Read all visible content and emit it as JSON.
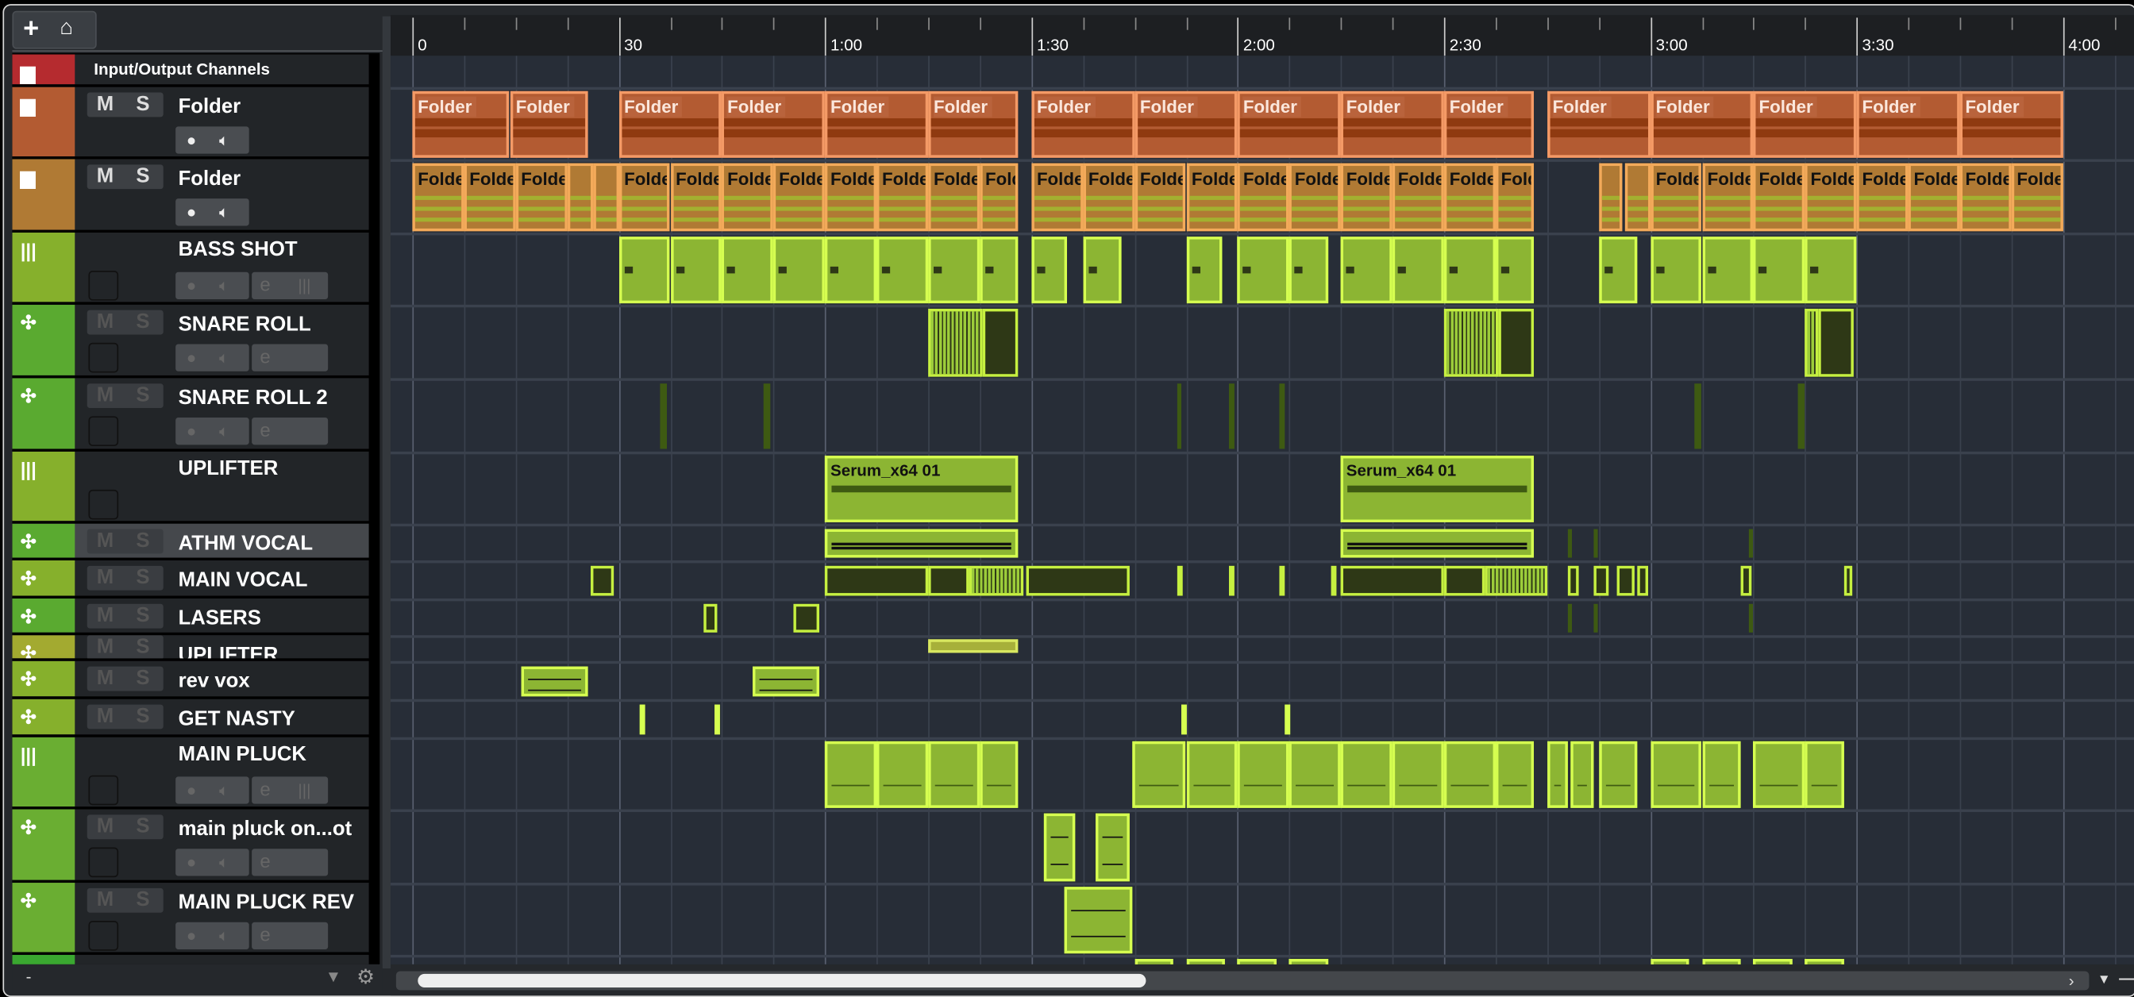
{
  "toolbar": {
    "add_icon": "+",
    "folder_icon": "⌂"
  },
  "ruler": {
    "labels": [
      "0",
      "30",
      "1:00",
      "1:30",
      "2:00",
      "2:30",
      "3:00",
      "3:30",
      "4:00"
    ],
    "bars_per_label": 4,
    "total_bars": 33.5
  },
  "footer": {
    "minus": "-"
  },
  "colors": {
    "io": "#b52b2f",
    "folder1": "#b35b32",
    "folder2": "#b07a34",
    "green": "#86b02c",
    "green2": "#5aaa30",
    "yellow": "#a3aa30"
  },
  "tracks": [
    {
      "name": "Input/Output Channels",
      "type": "io",
      "color": "#b52b2f",
      "icon": "folder-icon",
      "rows": 24,
      "clips": []
    },
    {
      "name": "Folder",
      "type": "folder",
      "color": "#b35b32",
      "icon": "folder-icon",
      "rows": 53,
      "style": "f1",
      "clip_label": "Folder",
      "clips": [
        [
          0,
          1.87
        ],
        [
          1.9,
          3.4
        ],
        [
          4,
          6
        ],
        [
          6,
          8
        ],
        [
          8,
          10
        ],
        [
          10,
          11.75
        ],
        [
          12,
          14
        ],
        [
          14,
          16
        ],
        [
          16,
          18
        ],
        [
          18,
          20
        ],
        [
          20,
          21.75
        ],
        [
          22,
          24
        ],
        [
          24,
          26
        ],
        [
          26,
          28
        ],
        [
          28,
          30
        ],
        [
          30,
          32
        ]
      ]
    },
    {
      "name": "Folder",
      "type": "folder",
      "color": "#b07a34",
      "icon": "folder-icon",
      "rows": 54,
      "style": "f2",
      "clip_label": "Folde",
      "clips": [
        [
          0,
          1
        ],
        [
          1,
          2
        ],
        [
          2,
          3
        ],
        [
          3,
          3.5,
          ""
        ],
        [
          3.5,
          4,
          ""
        ],
        [
          4,
          5
        ],
        [
          5,
          6
        ],
        [
          6,
          7
        ],
        [
          7,
          8
        ],
        [
          8,
          9
        ],
        [
          9,
          10
        ],
        [
          10,
          11
        ],
        [
          11,
          11.75
        ],
        [
          12,
          13
        ],
        [
          13,
          14
        ],
        [
          14,
          15
        ],
        [
          15,
          16
        ],
        [
          16,
          17
        ],
        [
          17,
          18
        ],
        [
          18,
          19
        ],
        [
          19,
          20
        ],
        [
          20,
          21
        ],
        [
          21,
          21.75
        ],
        [
          23,
          23.45,
          ""
        ],
        [
          23.5,
          24,
          ""
        ],
        [
          24,
          25
        ],
        [
          25,
          26
        ],
        [
          26,
          27
        ],
        [
          27,
          28
        ],
        [
          28,
          29
        ],
        [
          29,
          30
        ],
        [
          30,
          31
        ],
        [
          31,
          32
        ]
      ]
    },
    {
      "name": "BASS SHOT",
      "type": "inst",
      "color": "#86b02c",
      "icon": "piano-icon",
      "rows": 53,
      "style": "g",
      "clips": [
        [
          4,
          5
        ],
        [
          5,
          6
        ],
        [
          6,
          7
        ],
        [
          7,
          8
        ],
        [
          8,
          9
        ],
        [
          9,
          10
        ],
        [
          10,
          11
        ],
        [
          11,
          11.75
        ],
        [
          12,
          12.7
        ],
        [
          13,
          13.75
        ],
        [
          15,
          15.7
        ],
        [
          16,
          17
        ],
        [
          17,
          17.75
        ],
        [
          18,
          19
        ],
        [
          19,
          20
        ],
        [
          20,
          21
        ],
        [
          21,
          21.75
        ],
        [
          23,
          23.75
        ],
        [
          24,
          25
        ],
        [
          25,
          26
        ],
        [
          26,
          27
        ],
        [
          27,
          28
        ]
      ]
    },
    {
      "name": "SNARE ROLL",
      "type": "audio",
      "color": "#5aaa30",
      "icon": "waveform-icon",
      "rows": 54,
      "style": "roll",
      "clips": [
        [
          10,
          11.05
        ],
        [
          11.05,
          11.75,
          "",
          "gd"
        ],
        [
          20,
          21.05
        ],
        [
          21.05,
          21.75,
          "",
          "gd"
        ],
        [
          27,
          27.25
        ],
        [
          27.25,
          27.95,
          "",
          "gd"
        ]
      ]
    },
    {
      "name": "SNARE ROLL 2",
      "type": "audio",
      "color": "#5aaa30",
      "icon": "waveform-icon",
      "rows": 54,
      "style": "mk",
      "clips": [
        [
          4.8,
          4.93
        ],
        [
          6.8,
          6.93
        ],
        [
          14.82,
          14.92
        ],
        [
          15.82,
          15.95
        ],
        [
          16.82,
          16.92
        ],
        [
          24.85,
          24.98
        ],
        [
          26.85,
          26.98
        ]
      ]
    },
    {
      "name": "UPLIFTER",
      "type": "inst2",
      "color": "#86b02c",
      "icon": "piano-icon",
      "rows": 53,
      "style": "g",
      "clip_label": "Serum_x64 01",
      "clips": [
        [
          8,
          11.75
        ],
        [
          18,
          21.75
        ]
      ]
    },
    {
      "name": "ATHM VOCAL",
      "type": "short",
      "color": "#5aaa30",
      "icon": "waveform-icon",
      "rows": 27,
      "style": "g",
      "selected": true,
      "clips": [
        [
          8,
          11.75,
          "",
          "wv"
        ],
        [
          18,
          21.75,
          "",
          "wv"
        ],
        [
          22.4,
          22.45,
          "",
          "mk"
        ],
        [
          22.9,
          22.95,
          "",
          "mk"
        ],
        [
          25.9,
          25.95,
          "",
          "mk"
        ]
      ]
    },
    {
      "name": "MAIN VOCAL",
      "type": "short",
      "color": "#86b02c",
      "icon": "waveform-icon",
      "rows": 28,
      "style": "gd",
      "clips": [
        [
          3.45,
          3.9
        ],
        [
          8,
          10
        ],
        [
          10,
          10.8
        ],
        [
          10.8,
          11.85,
          "",
          "roll"
        ],
        [
          11.9,
          13.9
        ],
        [
          14.82,
          14.92
        ],
        [
          15.82,
          15.92
        ],
        [
          16.82,
          16.92
        ],
        [
          17.82,
          17.92
        ],
        [
          18,
          20
        ],
        [
          20,
          20.8
        ],
        [
          20.8,
          22,
          "",
          "roll"
        ],
        [
          22.4,
          22.6
        ],
        [
          22.9,
          23.2
        ],
        [
          23.35,
          23.7
        ],
        [
          23.75,
          23.95
        ],
        [
          25.75,
          25.95
        ],
        [
          27.75,
          27.92
        ]
      ]
    },
    {
      "name": "LASERS",
      "type": "short",
      "color": "#5aaa30",
      "icon": "waveform-icon",
      "rows": 27,
      "style": "gd",
      "clips": [
        [
          5.65,
          5.9
        ],
        [
          7.4,
          7.88
        ],
        [
          22.4,
          22.45,
          "",
          "mk"
        ],
        [
          22.9,
          22.95,
          "",
          "mk"
        ],
        [
          25.9,
          25.95,
          "",
          "mk"
        ]
      ]
    },
    {
      "name": "UPLIFTER",
      "type": "short",
      "color": "#a3aa30",
      "icon": "waveform-icon",
      "rows": 19,
      "style": "y",
      "clips": [
        [
          10,
          11.75
        ]
      ]
    },
    {
      "name": "rev vox",
      "type": "short",
      "color": "#86b02c",
      "icon": "waveform-icon",
      "rows": 28,
      "style": "g",
      "clips": [
        [
          2.1,
          3.4,
          "",
          "rv"
        ],
        [
          6.6,
          7.9,
          "",
          "rv"
        ]
      ]
    },
    {
      "name": "GET NASTY",
      "type": "short",
      "color": "#86b02c",
      "icon": "waveform-icon",
      "rows": 28,
      "style": "g",
      "clips": [
        [
          4.4,
          4.52
        ],
        [
          5.87,
          5.97
        ],
        [
          14.9,
          15.0
        ],
        [
          16.9,
          17.0
        ]
      ]
    },
    {
      "name": "MAIN PLUCK",
      "type": "inst",
      "color": "#6aae32",
      "icon": "piano-icon",
      "rows": 53,
      "style": "g",
      "clips": [
        [
          8,
          9
        ],
        [
          9,
          10
        ],
        [
          10,
          11
        ],
        [
          11,
          11.75
        ],
        [
          13.95,
          15
        ],
        [
          15,
          16
        ],
        [
          16,
          17
        ],
        [
          17,
          18
        ],
        [
          18,
          19
        ],
        [
          19,
          20
        ],
        [
          20,
          21
        ],
        [
          21,
          21.75
        ],
        [
          22,
          22.4
        ],
        [
          22.45,
          22.9
        ],
        [
          23,
          23.75
        ],
        [
          24,
          25
        ],
        [
          25,
          25.75
        ],
        [
          26,
          27
        ],
        [
          27,
          27.75
        ]
      ]
    },
    {
      "name": "main pluck on...ot",
      "type": "audio",
      "color": "#6aae32",
      "icon": "waveform-icon",
      "rows": 54,
      "style": "g",
      "clips": [
        [
          12.25,
          12.85,
          "",
          "rv"
        ],
        [
          13.25,
          13.9,
          "",
          "rv"
        ]
      ]
    },
    {
      "name": "MAIN PLUCK REV",
      "type": "audio",
      "color": "#6aae32",
      "icon": "waveform-icon",
      "rows": 53,
      "style": "g",
      "clips": [
        [
          12.65,
          13.95,
          "",
          "rv"
        ]
      ]
    },
    {
      "name": "",
      "type": "partial",
      "color": "#3aa830",
      "icon": "piano-icon",
      "rows": 20,
      "style": "g",
      "clips": [
        [
          14,
          14.75
        ],
        [
          15,
          15.75
        ],
        [
          16,
          16.75
        ],
        [
          17,
          17.75
        ],
        [
          24,
          24.75
        ],
        [
          25,
          25.75
        ],
        [
          26,
          26.75
        ],
        [
          27,
          27.75
        ]
      ]
    }
  ]
}
